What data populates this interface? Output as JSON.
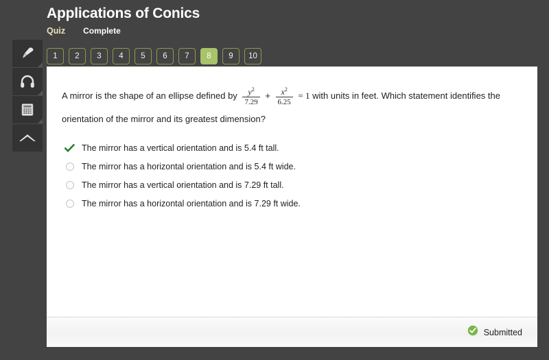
{
  "header": {
    "title": "Applications of Conics",
    "assignment_type": "Quiz",
    "status": "Complete"
  },
  "tools": [
    {
      "name": "highlighter-icon",
      "label": "Highlighter"
    },
    {
      "name": "headphones-icon",
      "label": "Read aloud"
    },
    {
      "name": "calculator-icon",
      "label": "Calculator"
    },
    {
      "name": "collapse-up-icon",
      "label": "Collapse"
    }
  ],
  "question_nav": {
    "items": [
      "1",
      "2",
      "3",
      "4",
      "5",
      "6",
      "7",
      "8",
      "9",
      "10"
    ],
    "active": "8"
  },
  "question": {
    "stem_part1": "A mirror is the shape of an ellipse defined by",
    "fraction1": {
      "numerator": "y",
      "numerator_exp": "2",
      "denominator": "7.29"
    },
    "operator": "+",
    "fraction2": {
      "numerator": "x",
      "numerator_exp": "2",
      "denominator": "6.25"
    },
    "equals": "= 1",
    "stem_part2": "with units in feet. Which statement identifies the",
    "stem_part3": "orientation of the mirror and its greatest dimension?"
  },
  "answers": [
    {
      "text": "The mirror has a vertical orientation and is 5.4 ft tall.",
      "selected": true
    },
    {
      "text": "The mirror has a horizontal orientation and is 5.4 ft wide.",
      "selected": false
    },
    {
      "text": "The mirror has a vertical orientation and is 7.29 ft tall.",
      "selected": false
    },
    {
      "text": "The mirror has a horizontal orientation and is 7.29 ft wide.",
      "selected": false
    }
  ],
  "footer": {
    "submitted_label": "Submitted",
    "submitted_icon": "check-circle-icon"
  },
  "colors": {
    "page_background": "#434343",
    "tile_background": "#333333",
    "accent_green": "#a9c36b",
    "nav_border": "#8b9a4f",
    "quiz_label": "#e9e3bd",
    "check_green": "#2f7d32",
    "submitted_green": "#7ab648"
  }
}
